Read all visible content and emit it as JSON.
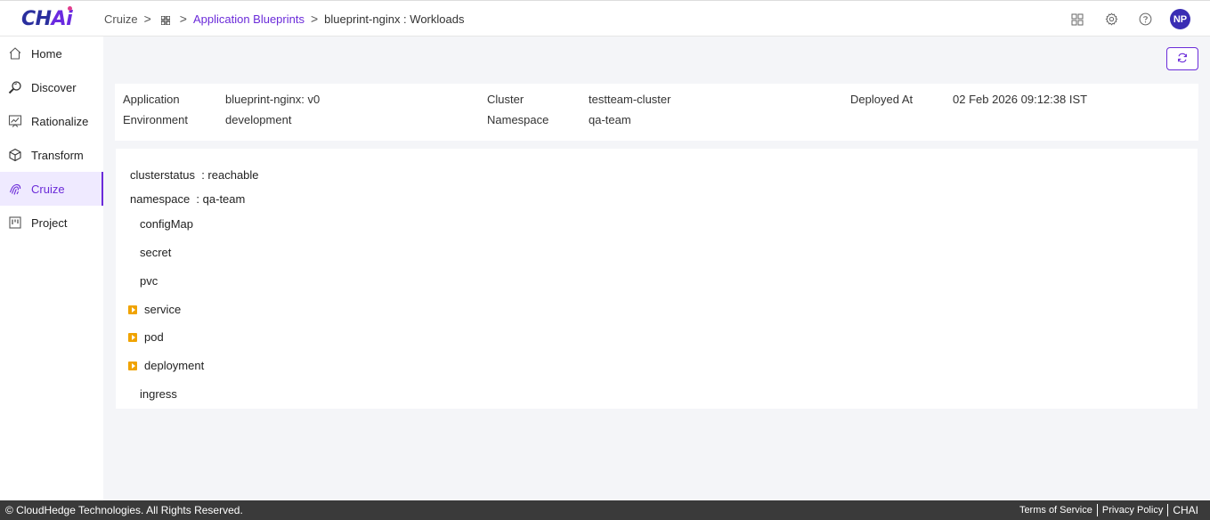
{
  "brand": {
    "logo_main": "CH",
    "logo_accent": "Ai"
  },
  "breadcrumb": {
    "root": "Cruize",
    "separator": ">",
    "link": "Application Blueprints",
    "current": "blueprint-nginx : Workloads"
  },
  "header": {
    "avatar_initials": "NP"
  },
  "sidebar": {
    "items": [
      {
        "label": "Home",
        "icon": "home-icon"
      },
      {
        "label": "Discover",
        "icon": "discover-icon"
      },
      {
        "label": "Rationalize",
        "icon": "rationalize-icon"
      },
      {
        "label": "Transform",
        "icon": "cube-icon"
      },
      {
        "label": "Cruize",
        "icon": "fingerprint-icon",
        "active": true
      },
      {
        "label": "Project",
        "icon": "board-icon"
      }
    ]
  },
  "info": {
    "application_label": "Application",
    "application_value": "blueprint-nginx: v0",
    "environment_label": "Environment",
    "environment_value": "development",
    "cluster_label": "Cluster",
    "cluster_value": "testteam-cluster",
    "namespace_label": "Namespace",
    "namespace_value": "qa-team",
    "deployed_label": "Deployed At",
    "deployed_value": "02 Feb 2026 09:12:38 IST"
  },
  "tree": {
    "clusterstatus": "clusterstatus  : reachable",
    "namespace": "namespace  : qa-team",
    "nodes": [
      "configMap",
      "secret",
      "pvc",
      "service",
      "pod",
      "deployment",
      "ingress"
    ]
  },
  "footer": {
    "copyright": "© CloudHedge Technologies. All Rights Reserved.",
    "terms": "Terms of Service",
    "privacy": "Privacy Policy",
    "brand": "CHAI"
  },
  "colors": {
    "accent": "#6b2bd9",
    "expander": "#f0a300",
    "footer_bg": "#3a3a3a"
  }
}
